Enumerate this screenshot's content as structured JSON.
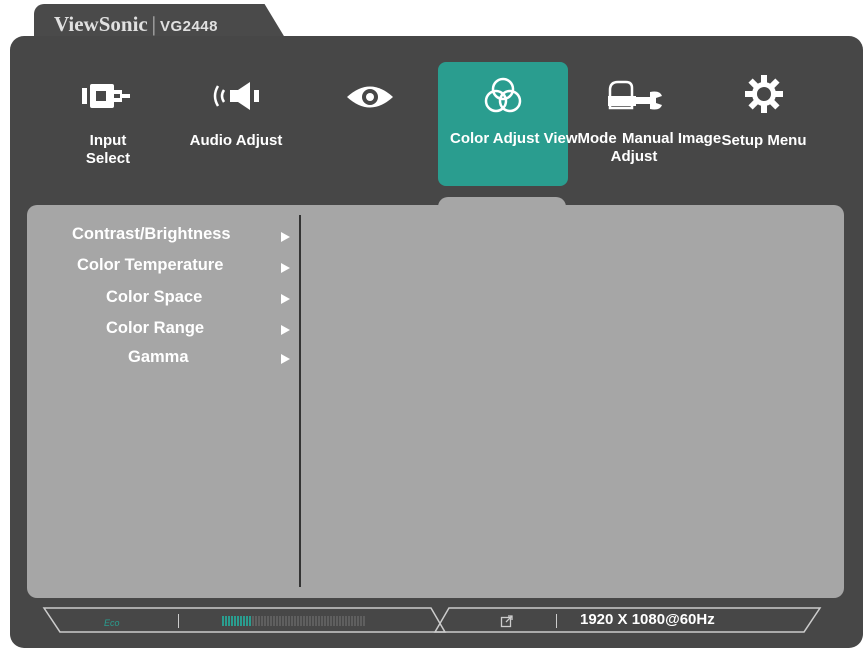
{
  "brand": {
    "name": "ViewSonic",
    "separator": "|",
    "model": "VG2448"
  },
  "main_menu": {
    "items": [
      {
        "id": "input-select",
        "label_line1": "Input",
        "label_line2": "Select",
        "icon": "input-connector-icon"
      },
      {
        "id": "audio-adjust",
        "label_line1": "Audio Adjust",
        "label_line2": "",
        "icon": "speaker-icon"
      },
      {
        "id": "view-mode",
        "label_line1": "",
        "label_line2": "",
        "icon": "eye-icon"
      },
      {
        "id": "color-adjust",
        "label_line1": "Color Adjust ViewMode",
        "label_line2": "",
        "icon": "color-circles-icon",
        "active": true
      },
      {
        "id": "manual-image-adjust",
        "label_line1": "Manual Image",
        "label_line2": "Adjust",
        "icon": "hand-wrench-icon"
      },
      {
        "id": "setup-menu",
        "label_line1": "Setup Menu",
        "label_line2": "",
        "icon": "gear-icon"
      }
    ]
  },
  "submenu": {
    "items": [
      {
        "label": "Contrast/Brightness"
      },
      {
        "label": "Color Temperature"
      },
      {
        "label": "Color Space"
      },
      {
        "label": "Color Range"
      },
      {
        "label": "Gamma"
      }
    ]
  },
  "status": {
    "eco_label": "Eco",
    "resolution": "1920 X 1080@60Hz",
    "level_fraction": 0.2
  },
  "colors": {
    "accent": "#2a9d8f",
    "frame": "#474747",
    "panel": "#a6a6a6"
  }
}
